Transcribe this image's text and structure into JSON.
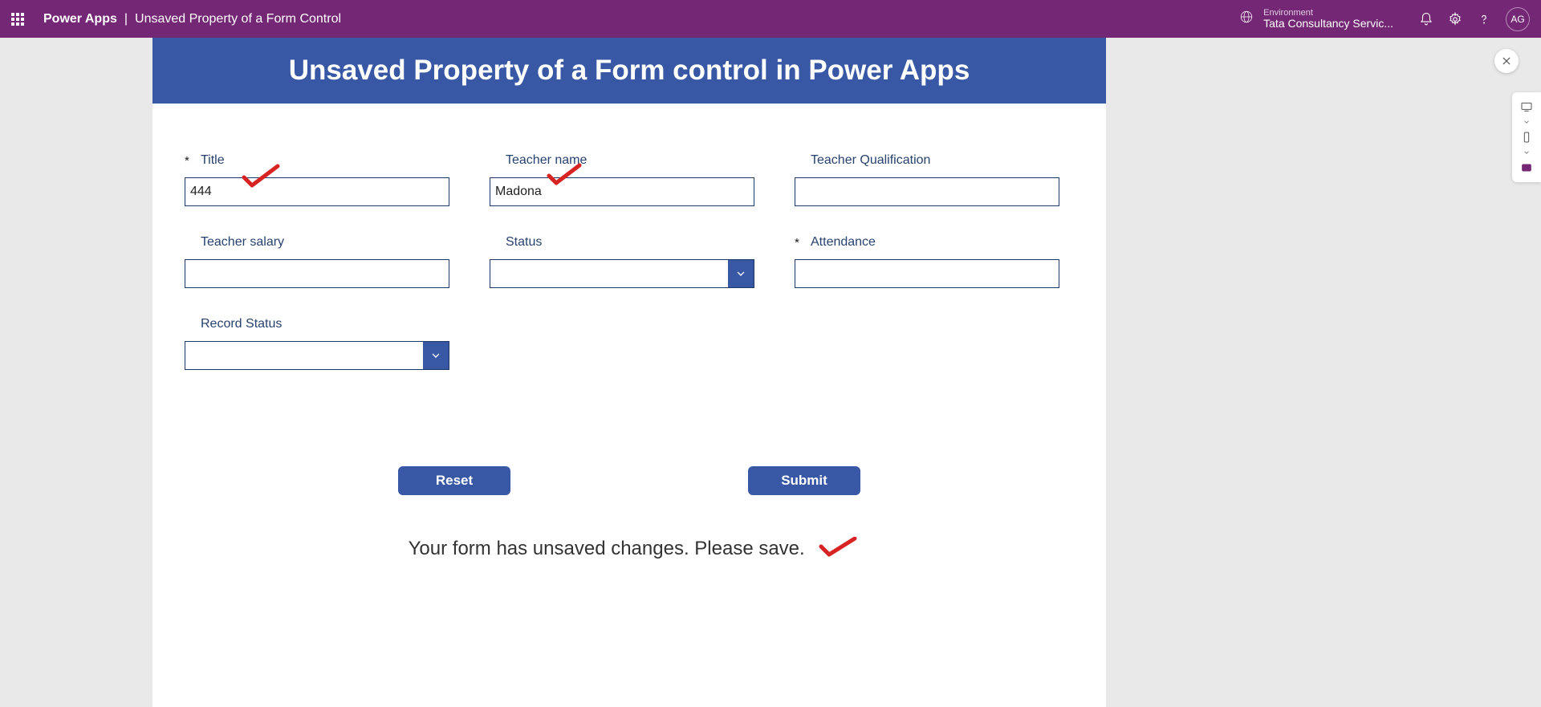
{
  "header": {
    "brand": "Power Apps",
    "separator": "|",
    "page_title": "Unsaved Property of a Form Control",
    "environment_label": "Environment",
    "environment_value": "Tata Consultancy Servic...",
    "avatar_initials": "AG"
  },
  "app": {
    "banner_title": "Unsaved Property of a Form control in Power Apps",
    "fields": {
      "title": {
        "label": "Title",
        "value": "444",
        "required": true
      },
      "teacher_name": {
        "label": "Teacher name",
        "value": "Madona",
        "required": false
      },
      "teacher_qualification": {
        "label": "Teacher Qualification",
        "value": "",
        "required": false
      },
      "teacher_salary": {
        "label": "Teacher salary",
        "value": "",
        "required": false
      },
      "status": {
        "label": "Status",
        "value": "",
        "required": false
      },
      "attendance": {
        "label": "Attendance",
        "value": "",
        "required": true
      },
      "record_status": {
        "label": "Record Status",
        "value": "",
        "required": false
      }
    },
    "buttons": {
      "reset": "Reset",
      "submit": "Submit"
    },
    "status_message": "Your form has unsaved changes. Please save."
  }
}
